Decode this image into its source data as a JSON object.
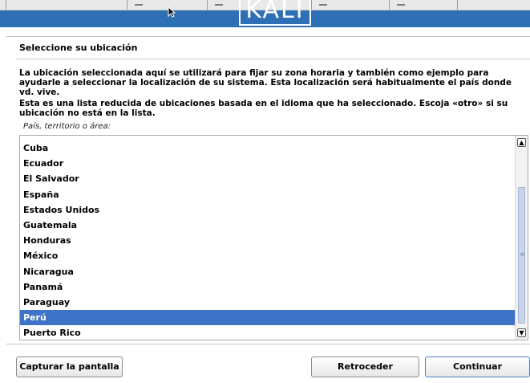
{
  "logo": {
    "text": "KALI"
  },
  "heading": "Seleccione su ubicación",
  "description1": "La ubicación seleccionada aquí se utilizará para fijar su zona horaria y también como ejemplo para ayudarle a seleccionar la localización de su sistema. Esta localización será habitualmente el país donde vd. vive.",
  "description2": "Esta es una lista reducida de ubicaciones basada en el idioma que ha seleccionado. Escoja «otro» si su ubicación no está en la lista.",
  "prompt": "País, territorio o área:",
  "list": {
    "items": [
      "Cuba",
      "Ecuador",
      "El Salvador",
      "España",
      "Estados Unidos",
      "Guatemala",
      "Honduras",
      "México",
      "Nicaragua",
      "Panamá",
      "Paraguay",
      "Perú",
      "Puerto Rico"
    ],
    "selected": "Perú"
  },
  "buttons": {
    "capture": "Capturar la pantalla",
    "back": "Retroceder",
    "continue": "Continuar"
  },
  "colors": {
    "header_blue": "#2f6fb5",
    "selection_blue": "#3f73c8"
  },
  "icons": {
    "scroll_up": "▲",
    "scroll_down": "▼",
    "grip": "≡"
  }
}
